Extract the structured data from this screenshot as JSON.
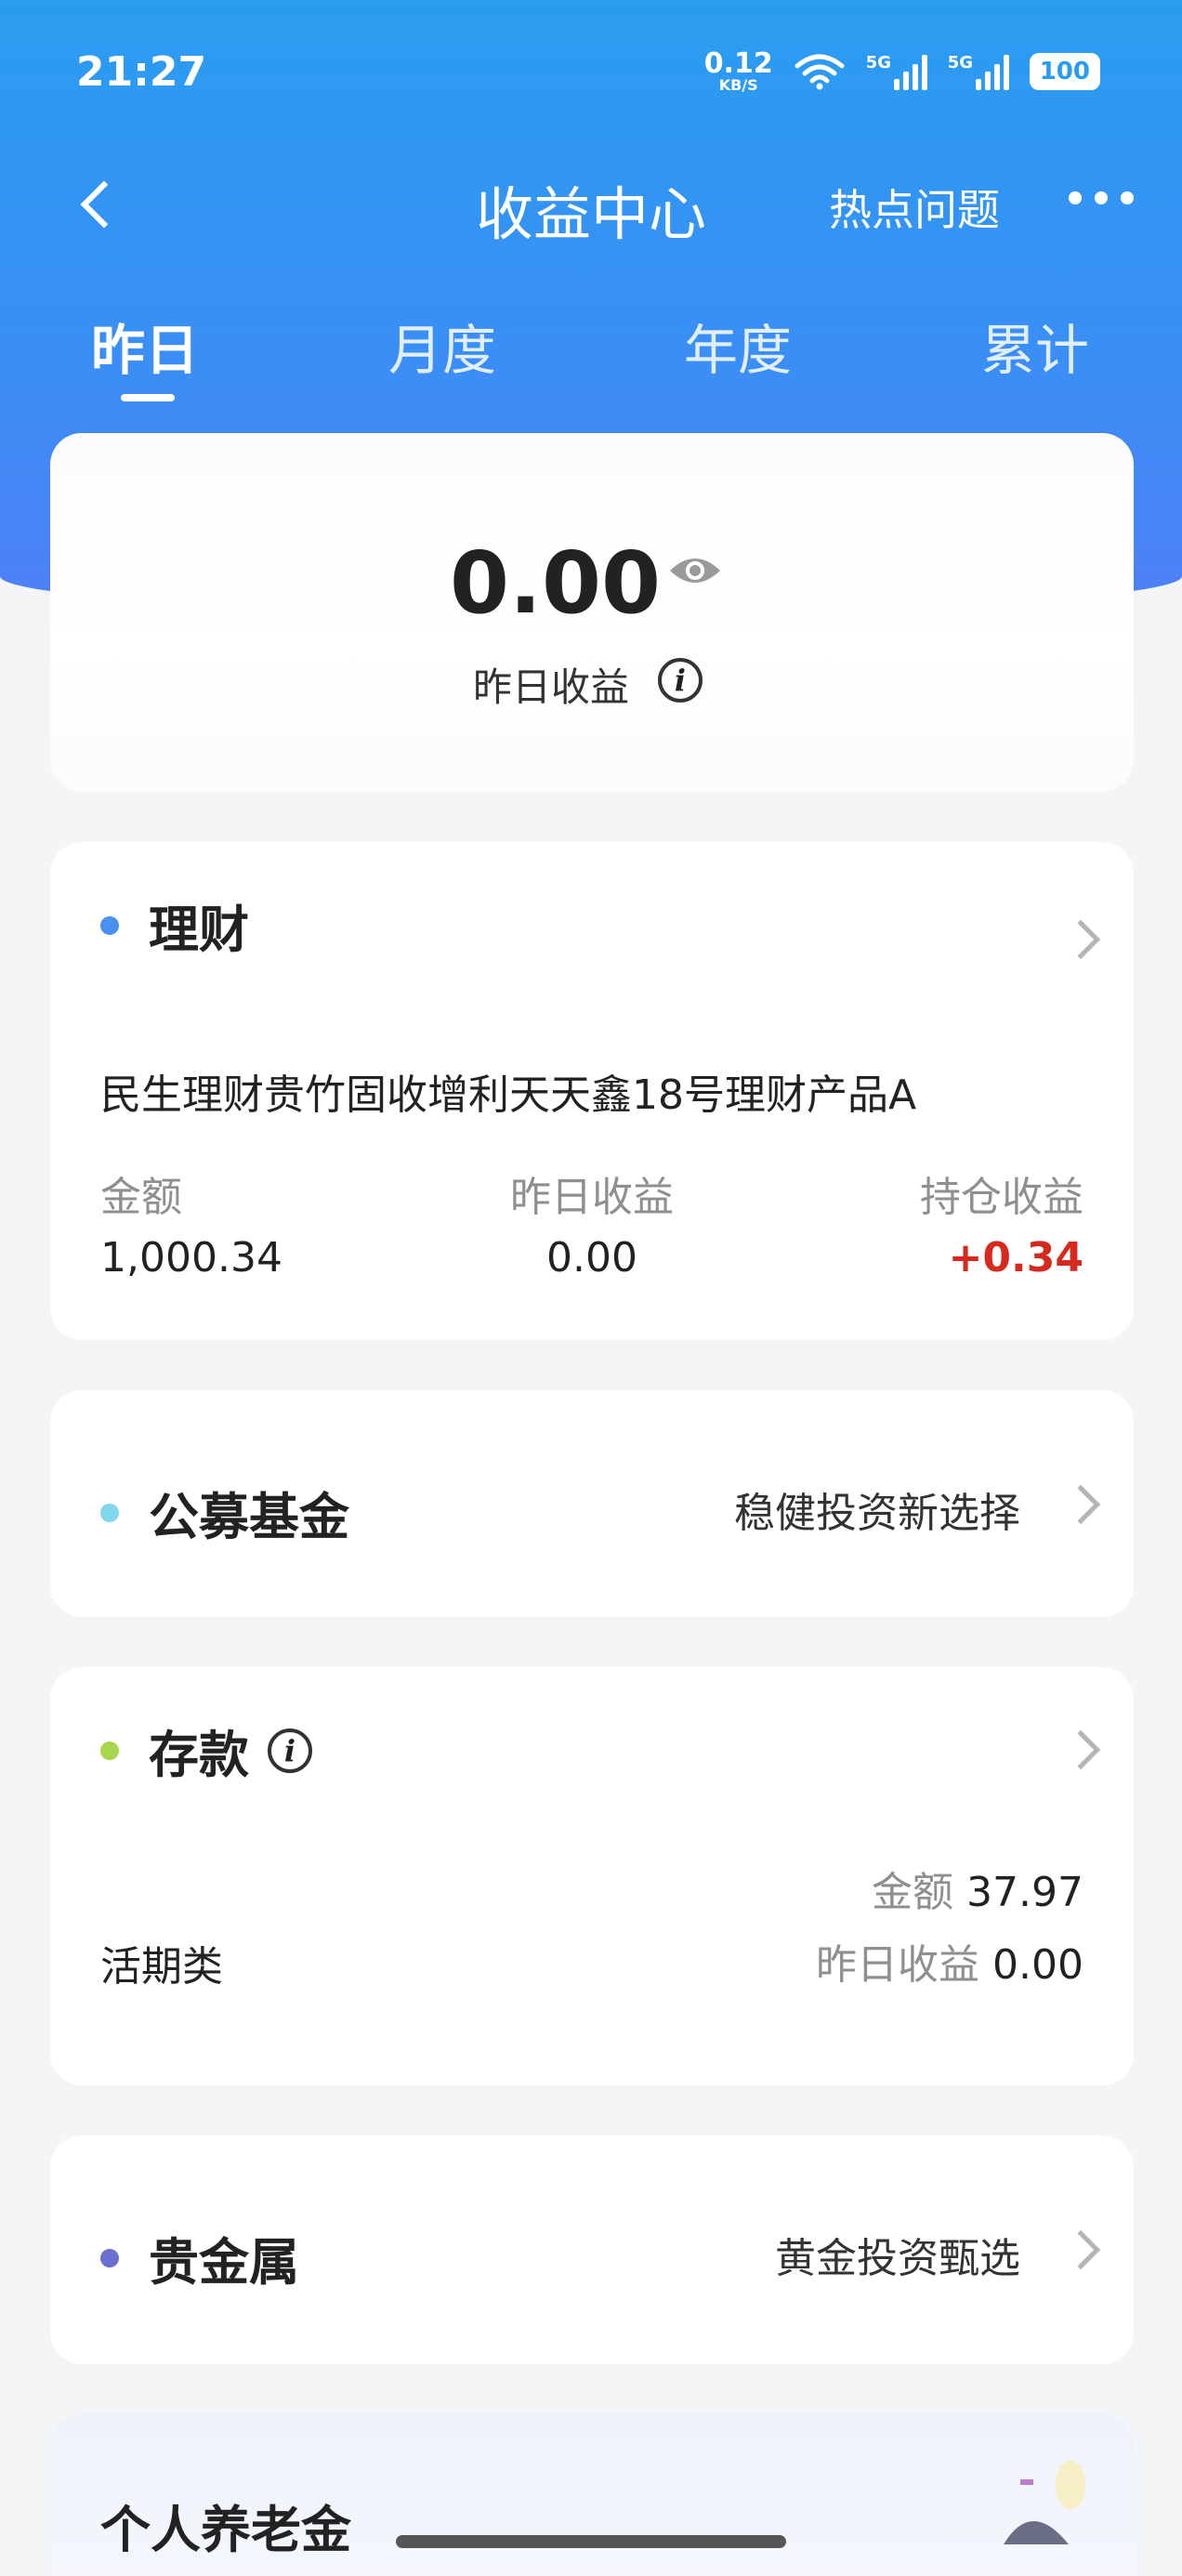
{
  "status": {
    "time": "21:27",
    "net_speed_value": "0.12",
    "net_speed_unit": "KB/S",
    "signal1_label": "5G",
    "signal2_label": "5G",
    "battery": "100"
  },
  "nav": {
    "title": "收益中心",
    "hot_questions": "热点问题"
  },
  "tabs": [
    {
      "label": "昨日",
      "active": true
    },
    {
      "label": "月度",
      "active": false
    },
    {
      "label": "年度",
      "active": false
    },
    {
      "label": "累计",
      "active": false
    }
  ],
  "summary": {
    "amount": "0.00",
    "label": "昨日收益",
    "info_icon": "i"
  },
  "wealth": {
    "title": "理财",
    "dot_color": "#4a90f0",
    "product_name": "民生理财贵竹固收增利天天鑫18号理财产品A",
    "col1_label": "金额",
    "col1_value": "1,000.34",
    "col2_label": "昨日收益",
    "col2_value": "0.00",
    "col3_label": "持仓收益",
    "col3_value": "+0.34"
  },
  "fund": {
    "title": "公募基金",
    "dot_color": "#7fd8ec",
    "subtitle": "稳健投资新选择"
  },
  "deposit": {
    "title": "存款",
    "dot_color": "#a8d64a",
    "info_icon": "i",
    "category": "活期类",
    "amount_label": "金额",
    "amount_value": "37.97",
    "yesterday_label": "昨日收益",
    "yesterday_value": "0.00"
  },
  "metal": {
    "title": "贵金属",
    "dot_color": "#6b6fd0",
    "subtitle": "黄金投资甄选"
  },
  "pension": {
    "title": "个人养老金"
  }
}
